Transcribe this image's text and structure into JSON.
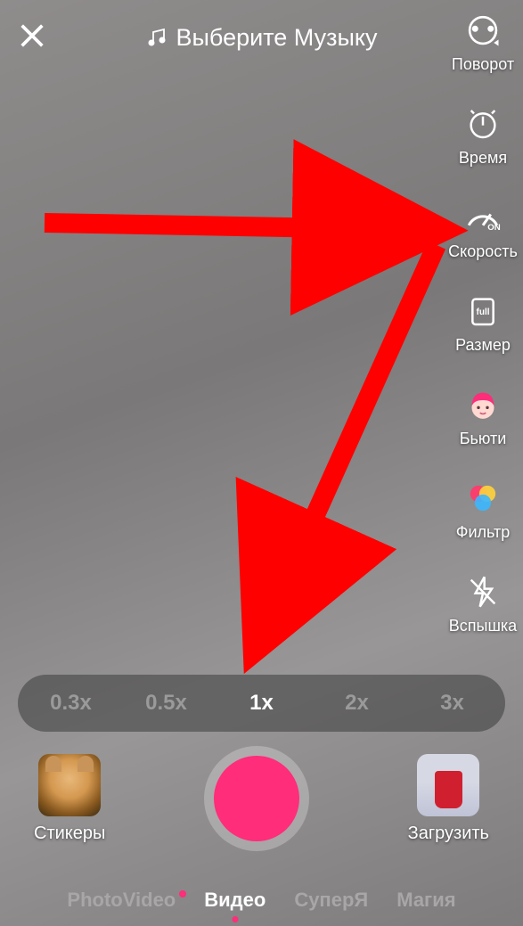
{
  "header": {
    "music_label": "Выберите Музыку"
  },
  "side": {
    "flip": {
      "label": "Поворот"
    },
    "timer": {
      "label": "Время"
    },
    "speed": {
      "label": "Скорость",
      "badge": "ON"
    },
    "size": {
      "label": "Размер",
      "badge": "full"
    },
    "beauty": {
      "label": "Бьюти"
    },
    "filter": {
      "label": "Фильтр"
    },
    "flash": {
      "label": "Вспышка"
    }
  },
  "speed_options": [
    "0.3x",
    "0.5x",
    "1x",
    "2x",
    "3x"
  ],
  "speed_active": "1x",
  "bottom": {
    "stickers_label": "Стикеры",
    "upload_label": "Загрузить"
  },
  "modes": {
    "items": [
      "PhotoVideo",
      "Видео",
      "СуперЯ",
      "Магия"
    ],
    "active": "Видео",
    "has_dot": "PhotoVideo"
  },
  "colors": {
    "accent": "#ff2d7a",
    "annotation": "#ff0000"
  }
}
